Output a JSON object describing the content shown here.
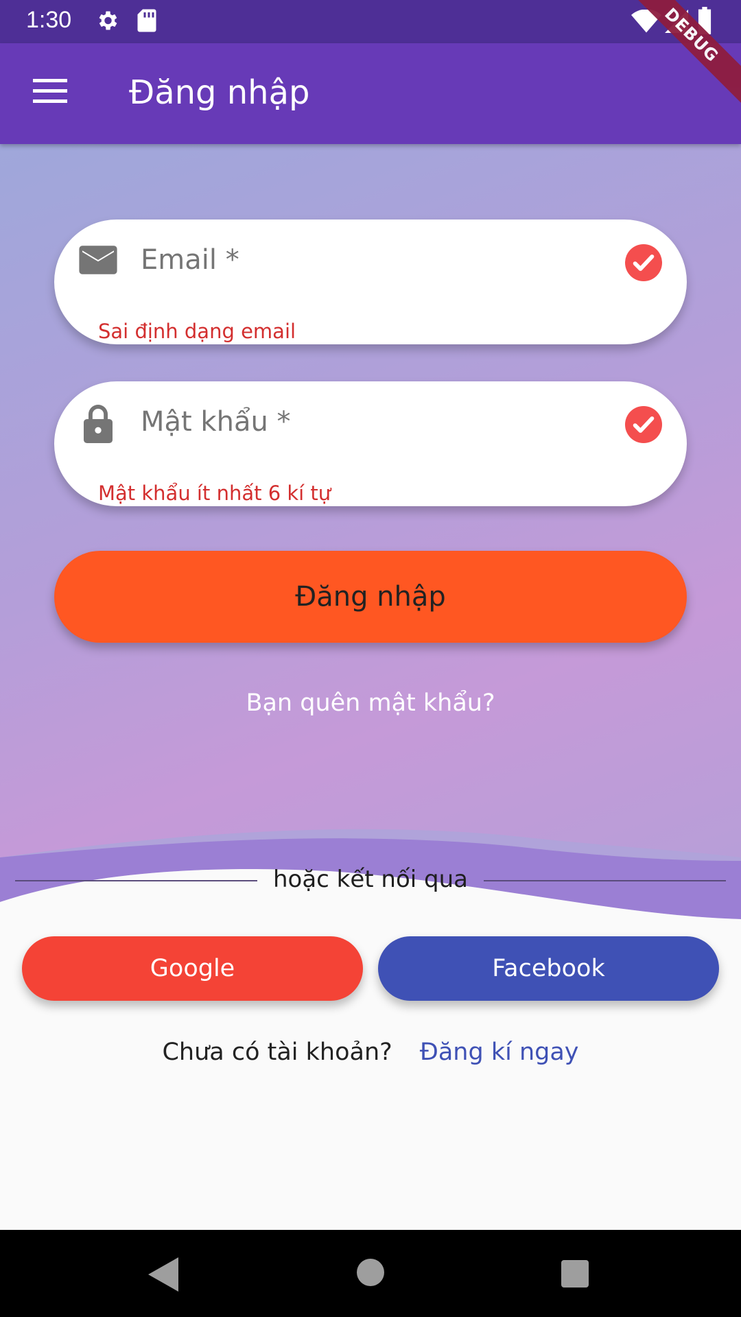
{
  "status_bar": {
    "time": "1:30",
    "icons": [
      "gear-icon",
      "sd-card-icon",
      "wifi-icon",
      "signal-icon",
      "battery-icon"
    ],
    "debug_label": "DEBUG"
  },
  "app_bar": {
    "title": "Đăng nhập",
    "menu_icon": "menu-icon",
    "color": "#673ab7"
  },
  "form": {
    "email": {
      "label": "Email *",
      "icon": "mail-icon",
      "error": "Sai định dạng email",
      "status_icon": "check-circle-icon"
    },
    "password": {
      "label": "Mật khẩu *",
      "icon": "lock-icon",
      "error": "Mật khẩu ít nhất 6 kí tự",
      "status_icon": "check-circle-icon"
    },
    "login_button": "Đăng nhập",
    "forgot_password": "Bạn quên mật khẩu?"
  },
  "social": {
    "divider_text": "hoặc kết nối qua",
    "google_label": "Google",
    "facebook_label": "Facebook"
  },
  "signup": {
    "question": "Chưa có tài khoản?",
    "link": "Đăng kí ngay"
  },
  "colors": {
    "accent": "#ff5722",
    "error": "#d32f2f",
    "check": "#f44e4e",
    "google": "#f44336",
    "facebook": "#3f51b5"
  },
  "nav_bar": {
    "icons": [
      "back-icon",
      "home-icon",
      "recents-icon"
    ]
  }
}
